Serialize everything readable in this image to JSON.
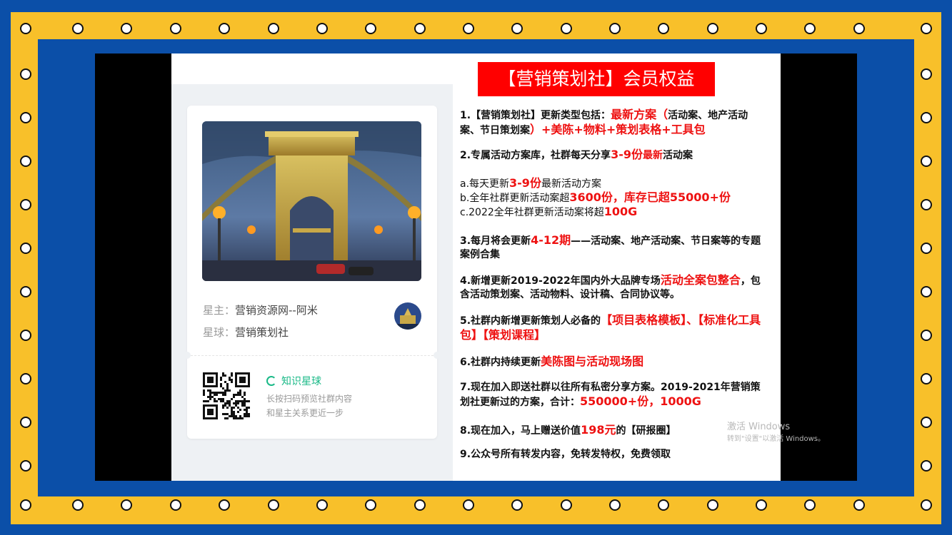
{
  "title": "【营销策划社】会员权益",
  "card": {
    "owner_key": "星主：",
    "owner_value": "营销资源网--阿米",
    "planet_key": "星球：",
    "planet_value": "营销策划社",
    "brand": "知识星球",
    "scan_line1": "长按扫码预览社群内容",
    "scan_line2": "和星主关系更近一步"
  },
  "items": {
    "i1": {
      "a": "1.【营销策划社】更新类型包括：",
      "r1": "最新方案（",
      "b": "活动案、地产活动案、节日策划案",
      "r2": "）+美陈+物料+策划表格+工具包"
    },
    "i2": {
      "a": "2.专属活动方案库，社群每天分享",
      "r1": "3-9份",
      "r2": "最新",
      "b": "活动案"
    },
    "ia": {
      "a": "a.每天更新",
      "r": "3-9份",
      "b": "最新活动方案"
    },
    "ib": {
      "a": "b.全年社群更新活动案超",
      "r": "3600份，库存已超55000+份"
    },
    "ic": {
      "a": "c.2022全年社群更新活动案将超",
      "r": "100G"
    },
    "i3": {
      "a": "3.每月将会更新",
      "r": "4-12期",
      "b": "——活动案、地产活动案、节日案等的专题案例合集"
    },
    "i4": {
      "a": "4.新增更新2019-2022年国内外大品牌专场",
      "r": "活动全案包整合",
      "b": "，包含活动策划案、活动物料、设计稿、合同协议等。"
    },
    "i5": {
      "a": "5.社群内新增更新策划人必备的",
      "r": "【项目表格模板】、【标准化工具包】【策划课程】"
    },
    "i6": {
      "a": "6.社群内持续更新",
      "r": "美陈图与活动现场图"
    },
    "i7": {
      "a": "7.现在加入即送社群以往所有私密分享方案。2019-2021年营销策划社更新过的方案，合计：",
      "r": "550000+份，1000G"
    },
    "i8": {
      "a": "8.现在加入，马上赠送价值",
      "r": "198元",
      "b": "的【研报圈】"
    },
    "i9": {
      "a": "9.公众号所有转发内容，免转发特权，免费领取"
    }
  },
  "watermark": {
    "line1": "激活 Windows",
    "line2": "转到\"设置\"以激活 Windows。"
  },
  "colors": {
    "frame_blue": "#0b4fa8",
    "frame_yellow": "#f8c02a",
    "accent_red": "#ff0000",
    "brand_green": "#19b987"
  }
}
